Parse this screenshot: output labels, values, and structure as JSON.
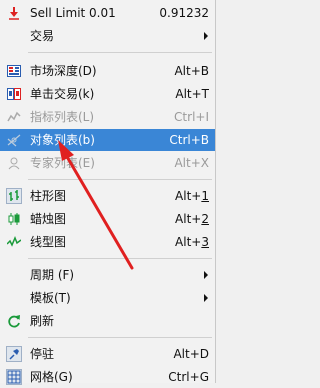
{
  "menu": {
    "items": [
      {
        "label": "Sell Limit 0.01",
        "accel": "0.91232",
        "icon": "sell-limit-icon",
        "state": "normal"
      },
      {
        "label": "交易",
        "accel": "",
        "icon": "",
        "state": "submenu"
      },
      {
        "label": "市场深度(D)",
        "accel": "Alt+B",
        "icon": "market-depth-icon",
        "state": "normal"
      },
      {
        "label": "单击交易(k)",
        "accel": "Alt+T",
        "icon": "one-click-trading-icon",
        "state": "normal"
      },
      {
        "label": "指标列表(L)",
        "accel": "Ctrl+I",
        "icon": "indicators-list-icon",
        "state": "disabled"
      },
      {
        "label": "对象列表(b)",
        "accel": "Ctrl+B",
        "icon": "objects-list-icon",
        "state": "selected"
      },
      {
        "label": "专家列表(E)",
        "accel": "Alt+X",
        "icon": "experts-list-icon",
        "state": "disabled"
      },
      {
        "label": "柱形图",
        "accel_prefix": "Alt+",
        "accel_underline": "1",
        "icon": "bar-chart-icon",
        "state": "normal"
      },
      {
        "label": "蜡烛图",
        "accel_prefix": "Alt+",
        "accel_underline": "2",
        "icon": "candlestick-icon",
        "state": "normal"
      },
      {
        "label": "线型图",
        "accel_prefix": "Alt+",
        "accel_underline": "3",
        "icon": "line-chart-icon",
        "state": "normal"
      },
      {
        "label": "周期 (F)",
        "accel": "",
        "icon": "",
        "state": "submenu"
      },
      {
        "label": "模板(T)",
        "accel": "",
        "icon": "",
        "state": "submenu"
      },
      {
        "label": "刷新",
        "accel": "",
        "icon": "refresh-icon",
        "state": "normal"
      },
      {
        "label": "停驻",
        "accel": "Alt+D",
        "icon": "dock-icon",
        "state": "normal"
      },
      {
        "label": "网格(G)",
        "accel": "Ctrl+G",
        "icon": "grid-icon",
        "state": "normal"
      }
    ]
  },
  "colors": {
    "selected_bg": "#3a86d6",
    "arrow": "#e02020"
  }
}
